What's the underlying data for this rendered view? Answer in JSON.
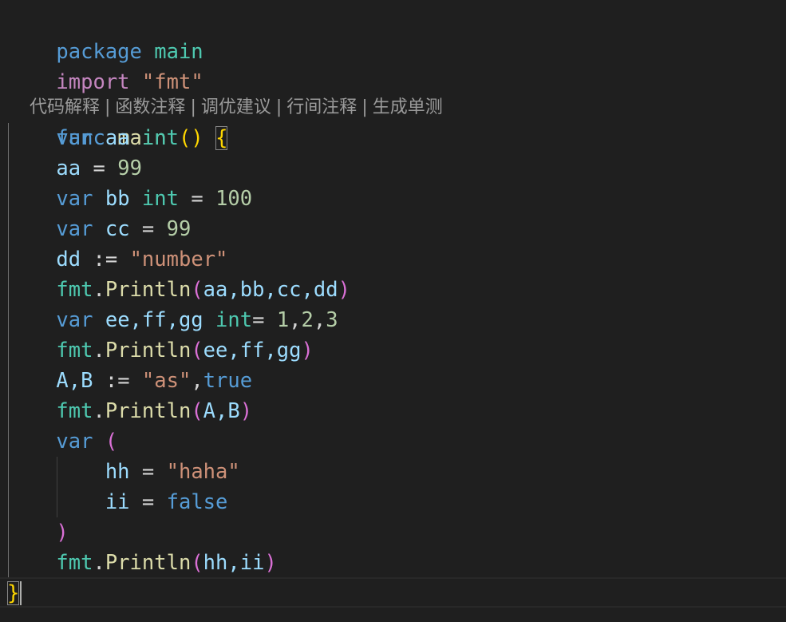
{
  "code": {
    "l1": {
      "kw": "package",
      "pkg": "main"
    },
    "l2": {
      "kw": "import",
      "str": "\"fmt\""
    },
    "codelens": {
      "a": "代码解释",
      "b": "函数注释",
      "c": "调优建议",
      "d": "行间注释",
      "e": "生成单测",
      "sep": "|"
    },
    "l3": {
      "kw": "func",
      "name": "main",
      "parens": "()",
      "brace": "{"
    },
    "l4": {
      "kw": "var",
      "id": "aa",
      "ty": "int"
    },
    "l5": {
      "id": "aa",
      "op": "=",
      "num": "99"
    },
    "l6": {
      "kw": "var",
      "id": "bb",
      "ty": "int",
      "op": "=",
      "num": "100"
    },
    "l7": {
      "kw": "var",
      "id": "cc",
      "op": "=",
      "num": "99"
    },
    "l8": {
      "id": "dd",
      "op": ":=",
      "str": "\"number\""
    },
    "l9": {
      "pkg": "fmt",
      "fn": "Println",
      "open": "(",
      "args": "aa,bb,cc,dd",
      "close": ")"
    },
    "l10": {
      "kw": "var",
      "ids": "ee,ff,gg",
      "ty": "int",
      "op": "=",
      "n1": "1",
      "n2": "2",
      "n3": "3"
    },
    "l11": {
      "pkg": "fmt",
      "fn": "Println",
      "open": "(",
      "args": "ee,ff,gg",
      "close": ")"
    },
    "l12": {
      "ids": "A,B",
      "op": ":=",
      "str": "\"as\"",
      "kw": "true"
    },
    "l13": {
      "pkg": "fmt",
      "fn": "Println",
      "open": "(",
      "args": "A,B",
      "close": ")"
    },
    "l14": {
      "kw": "var",
      "open": "("
    },
    "l15": {
      "id": "hh",
      "op": "=",
      "str": "\"haha\""
    },
    "l16": {
      "id": "ii",
      "op": "=",
      "kw": "false"
    },
    "l17": {
      "close": ")"
    },
    "l18": {
      "pkg": "fmt",
      "fn": "Println",
      "open": "(",
      "args": "hh,ii",
      "close": ")"
    },
    "l19": {
      "brace": "}"
    }
  },
  "colors": {
    "background": "#1f1f1f",
    "keyword": "#569cd6",
    "type": "#4ec9b0",
    "identifier": "#9cdcfe",
    "function": "#dcdcaa",
    "string": "#ce9178",
    "number": "#b5cea8",
    "bracket_gold": "#ffd700",
    "bracket_pink": "#da70d6"
  }
}
